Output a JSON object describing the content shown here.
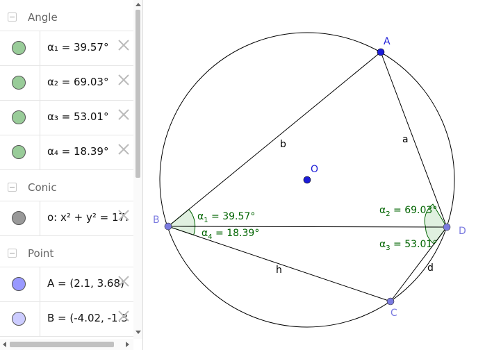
{
  "algebra": {
    "categories": {
      "angle": {
        "label": "Angle"
      },
      "conic": {
        "label": "Conic"
      },
      "point": {
        "label": "Point"
      }
    },
    "rows": [
      {
        "name": "α1",
        "expr": "α₁ = 39.57°",
        "color": "#99CC99"
      },
      {
        "name": "α2",
        "expr": "α₂ = 69.03°",
        "color": "#99CC99"
      },
      {
        "name": "α3",
        "expr": "α₃ = 53.01°",
        "color": "#99CC99"
      },
      {
        "name": "α4",
        "expr": "α₄ = 18.39°",
        "color": "#99CC99"
      },
      {
        "name": "o",
        "expr": "o: x² + y² = 17.",
        "color": "#999999"
      },
      {
        "name": "A",
        "expr": "A = (2.1, 3.68)",
        "color": "#9999FF"
      },
      {
        "name": "B",
        "expr": "B = (-4.02, -1.3",
        "color": "#CCCCFF"
      }
    ]
  },
  "graphics": {
    "points": {
      "A": {
        "label": "A",
        "color": "#1C1CD8"
      },
      "B": {
        "label": "B",
        "color": "#7B7BE0"
      },
      "C": {
        "label": "C",
        "color": "#7B7BE0"
      },
      "D": {
        "label": "D",
        "color": "#7B7BE0"
      },
      "O": {
        "label": "O",
        "color": "#1C1CD8"
      }
    },
    "segments": {
      "a": "a",
      "b": "b",
      "d": "d",
      "h": "h"
    },
    "angle_labels": {
      "alpha1": {
        "base": "α",
        "sub": "1",
        "value": " = 39.57°"
      },
      "alpha2": {
        "base": "α",
        "sub": "2",
        "value": " = 69.03°"
      },
      "alpha3": {
        "base": "α",
        "sub": "3",
        "value": " = 53.01°"
      },
      "alpha4": {
        "base": "α",
        "sub": "4",
        "value": " = 18.39°"
      }
    },
    "colors": {
      "angle": "#006400",
      "angle_fill": "#99CC99",
      "line": "#000000"
    }
  }
}
